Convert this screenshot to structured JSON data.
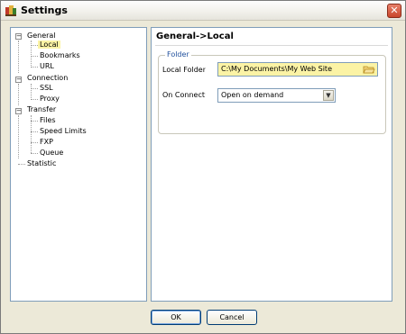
{
  "window": {
    "title": "Settings",
    "close_symbol": "✕",
    "app_icon": "settings-app-icon"
  },
  "tree": {
    "items": [
      {
        "label": "General",
        "level": 0,
        "expanded": true
      },
      {
        "label": "Local",
        "level": 1,
        "selected": true
      },
      {
        "label": "Bookmarks",
        "level": 1
      },
      {
        "label": "URL",
        "level": 1
      },
      {
        "label": "Connection",
        "level": 0,
        "expanded": true
      },
      {
        "label": "SSL",
        "level": 1
      },
      {
        "label": "Proxy",
        "level": 1
      },
      {
        "label": "Transfer",
        "level": 0,
        "expanded": true
      },
      {
        "label": "Files",
        "level": 1
      },
      {
        "label": "Speed Limits",
        "level": 1
      },
      {
        "label": "FXP",
        "level": 1
      },
      {
        "label": "Queue",
        "level": 1
      },
      {
        "label": "Statistic",
        "level": 0
      }
    ],
    "expander_symbol": "−"
  },
  "panel": {
    "title": "General->Local",
    "group_label": "Folder",
    "local_folder_label": "Local Folder",
    "local_folder_value": "C:\\My Documents\\My Web Site",
    "on_connect_label": "On Connect",
    "on_connect_value": "Open on demand",
    "dropdown_arrow": "▼"
  },
  "buttons": {
    "ok": "OK",
    "cancel": "Cancel"
  },
  "colors": {
    "highlight": "#fbf3a5",
    "group_label": "#1f4f9c",
    "border": "#7f9db9"
  }
}
